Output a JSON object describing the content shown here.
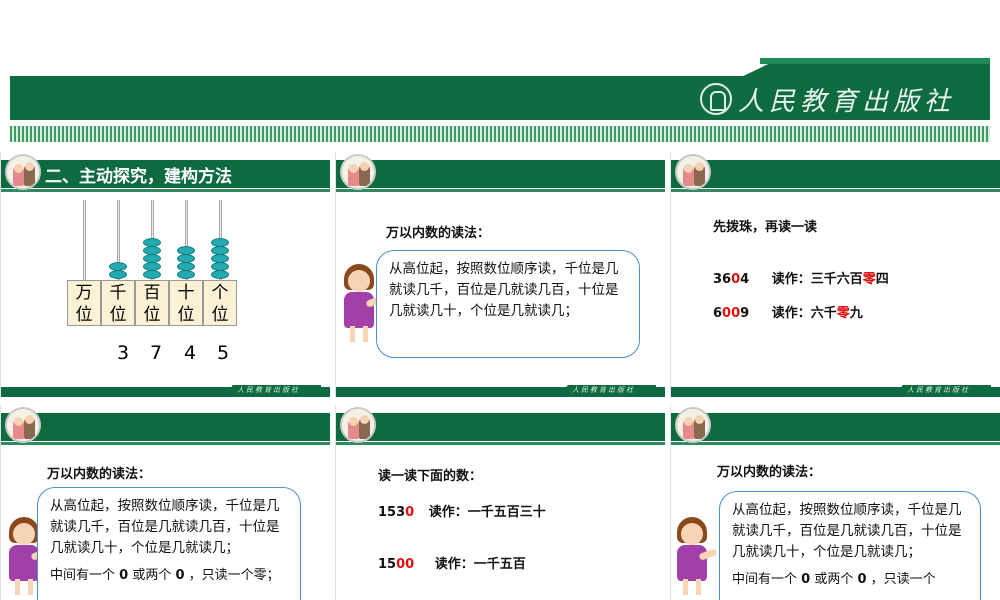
{
  "banner": {
    "publisher_logo_text": "人民教育出版社"
  },
  "slides": [
    {
      "section_title": "二、主动探究，建构方法",
      "place_labels": [
        [
          "万",
          "位"
        ],
        [
          "千",
          "位"
        ],
        [
          "百",
          "位"
        ],
        [
          "十",
          "位"
        ],
        [
          "个",
          "位"
        ]
      ],
      "digits": [
        "3",
        "7",
        "4",
        "5"
      ],
      "bead_counts": [
        0,
        2,
        5,
        4,
        5
      ]
    },
    {
      "heading": "万以内数的读法：",
      "bubble_text": "从高位起，按照数位顺序读，千位是几就读几千，百位是几就读几百，十位是几就读几十，个位是几就读几；"
    },
    {
      "heading": "先拨珠，再读一读",
      "rows": [
        {
          "num_a": "36",
          "num_zero": "0",
          "num_b": "4",
          "read_label": "读作：",
          "read_a": "三千六百",
          "read_zero": "零",
          "read_b": "四"
        },
        {
          "num_a": "6",
          "num_zero": "00",
          "num_b": "9",
          "read_label": "读作：",
          "read_a": "六千",
          "read_zero": "零",
          "read_b": "九"
        }
      ]
    },
    {
      "heading": "万以内数的读法：",
      "bubble_text": "从高位起，按照数位顺序读，千位是几就读几千，百位是几就读几百，十位是几就读几十，个位是几就读几；",
      "note_a": "中间有一个 ",
      "note_zero1": "0",
      "note_b": " 或两个 ",
      "note_zero2": "0",
      "note_c": " ，只读一个零；"
    },
    {
      "heading": "读一读下面的数：",
      "rows": [
        {
          "num_a": "153",
          "num_zero": "0",
          "read": "读作：一千五百三十"
        },
        {
          "num_a": "15",
          "num_zero": "00",
          "read": "读作：一千五百"
        }
      ]
    },
    {
      "heading": "万以内数的读法：",
      "bubble_text": "从高位起，按照数位顺序读，千位是几就读几千，百位是几就读几百，十位是几就读几十，个位是几就读几；",
      "note_a": "中间有一个 ",
      "note_zero1": "0",
      "note_b": " 或两个 ",
      "note_zero2": "0",
      "note_c": " ，只读一个"
    }
  ],
  "footer_logo_text": "人民教育出版社",
  "colors": {
    "brand_green": "#0d6a41",
    "bead_teal": "#21aab0",
    "highlight_red": "#e01010",
    "bubble_border": "#4a8fd0"
  }
}
